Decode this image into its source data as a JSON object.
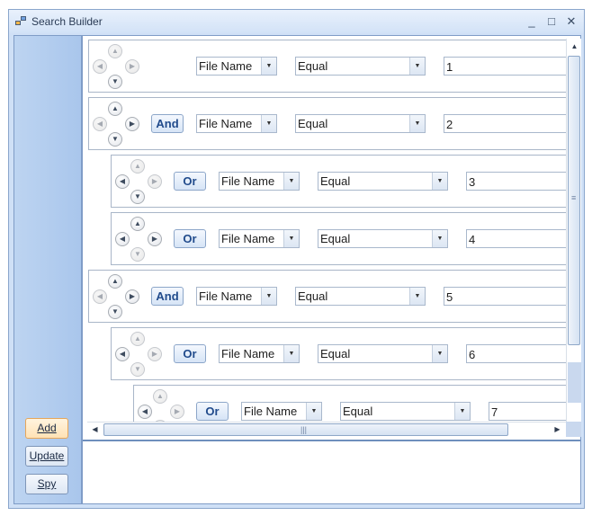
{
  "window": {
    "title": "Search Builder",
    "controls": {
      "minimize": "_",
      "maximize": "□",
      "close": "✕"
    }
  },
  "sidebar": {
    "add_label": "Add",
    "update_label": "Update",
    "spy_label": "Spy"
  },
  "rows": [
    {
      "logic": "",
      "field": "File Name",
      "operator": "Equal",
      "value": "1"
    },
    {
      "logic": "And",
      "field": "File Name",
      "operator": "Equal",
      "value": "2"
    },
    {
      "logic": "Or",
      "field": "File Name",
      "operator": "Equal",
      "value": "3"
    },
    {
      "logic": "Or",
      "field": "File Name",
      "operator": "Equal",
      "value": "4"
    },
    {
      "logic": "And",
      "field": "File Name",
      "operator": "Equal",
      "value": "5"
    },
    {
      "logic": "Or",
      "field": "File Name",
      "operator": "Equal",
      "value": "6"
    },
    {
      "logic": "Or",
      "field": "File Name",
      "operator": "Equal",
      "value": "7"
    }
  ],
  "icons": {
    "arrow_up": "▲",
    "arrow_down": "▼",
    "arrow_left": "◀",
    "arrow_right": "▶",
    "dropdown": "▼",
    "grip_v": "≡",
    "grip_h": "|||"
  },
  "colors": {
    "accent": "#214b8c",
    "window_bg": "#cfe0f6",
    "active_button": "#ffe2b5"
  }
}
